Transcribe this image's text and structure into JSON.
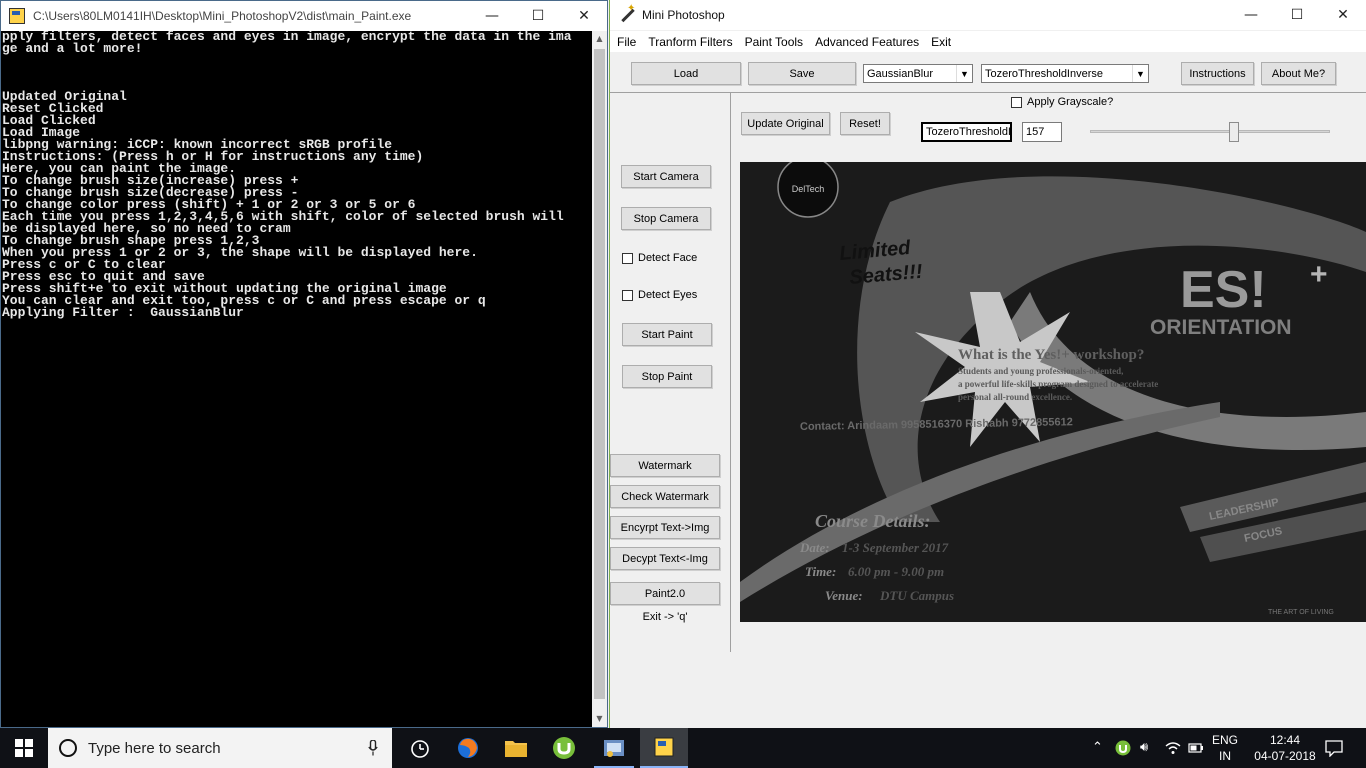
{
  "console": {
    "title": "C:\\Users\\80LM0141IH\\Desktop\\Mini_PhotoshopV2\\dist\\main_Paint.exe",
    "lines": [
      "pply filters, detect faces and eyes in image, encrypt the data in the ima",
      "ge and a lot more!",
      "",
      "",
      "",
      "Updated Original",
      "Reset Clicked",
      "Load Clicked",
      "Load Image",
      "libpng warning: iCCP: known incorrect sRGB profile",
      "Instructions: (Press h or H for instructions any time)",
      "Here, you can paint the image.",
      "To change brush size(increase) press +",
      "To change brush size(decrease) press -",
      "To change color press (shift) + 1 or 2 or 3 or 5 or 6",
      "Each time you press 1,2,3,4,5,6 with shift, color of selected brush will",
      "be displayed here, so no need to cram",
      "To change brush shape press 1,2,3",
      "When you press 1 or 2 or 3, the shape will be displayed here.",
      "Press c or C to clear",
      "Press esc to quit and save",
      "Press shift+e to exit without updating the original image",
      "You can clear and exit too, press c or C and press escape or q",
      "Applying Filter :  GaussianBlur"
    ]
  },
  "window_controls": {
    "minimize": "—",
    "maximize": "☐",
    "close": "✕"
  },
  "app": {
    "title": "Mini Photoshop",
    "menu": [
      "File",
      "Tranform Filters",
      "Paint Tools",
      "Advanced Features",
      "Exit"
    ],
    "toolbar": {
      "load": "Load",
      "save": "Save",
      "filter_select": "GaussianBlur",
      "threshold_select": "TozeroThresholdInverse",
      "instructions": "Instructions",
      "about": "About Me?"
    },
    "grayscale_label": "Apply Grayscale?",
    "update_original": "Update Original",
    "reset": "Reset!",
    "threshold_field": "TozeroThresholdInverse",
    "threshold_value": "157",
    "slider_value_fraction": 0.6,
    "side_buttons": {
      "start_camera": "Start Camera",
      "stop_camera": "Stop Camera",
      "detect_face": "Detect Face",
      "detect_eyes": "Detect Eyes",
      "start_paint": "Start Paint",
      "stop_paint": "Stop Paint",
      "watermark": "Watermark",
      "check_watermark": "Check Watermark",
      "encrypt": "Encyrpt Text->Img",
      "decrypt": "Decypt Text<-Img",
      "paint2": "Paint2.0",
      "exit_hint": "Exit -> 'q'"
    }
  },
  "poster": {
    "logo_text": "DelTech",
    "burst_line1": "Limited",
    "burst_line2": "Seats!!!",
    "yes_text": "ES!",
    "yes_plus": "+",
    "orientation": "ORIENTATION",
    "question": "What is the Yes!+ workshop?",
    "desc1": "Students and young professionals-oriented,",
    "desc2": "a powerful life-skills program designed to accelerate",
    "desc3": "personal all-round excellence.",
    "contact": "Contact: Arindaam 9958516370 Rishabh 9772855612",
    "course": "Course Details:",
    "date_label": "Date:",
    "date_val": "1-3 September 2017",
    "time_label": "Time:",
    "time_val": "6.00 pm - 9.00 pm",
    "venue_label": "Venue:",
    "venue_val": "DTU Campus",
    "leadership": "LEADERSHIP",
    "focus": "FOCUS",
    "art": "THE ART OF LIVING"
  },
  "taskbar": {
    "search_placeholder": "Type here to search",
    "lang_line1": "ENG",
    "lang_line2": "IN",
    "time": "12:44",
    "date": "04-07-2018"
  },
  "colors": {
    "accent": "#8ab4f8",
    "console_bg": "#000000",
    "window_border": "#7fb04d"
  }
}
